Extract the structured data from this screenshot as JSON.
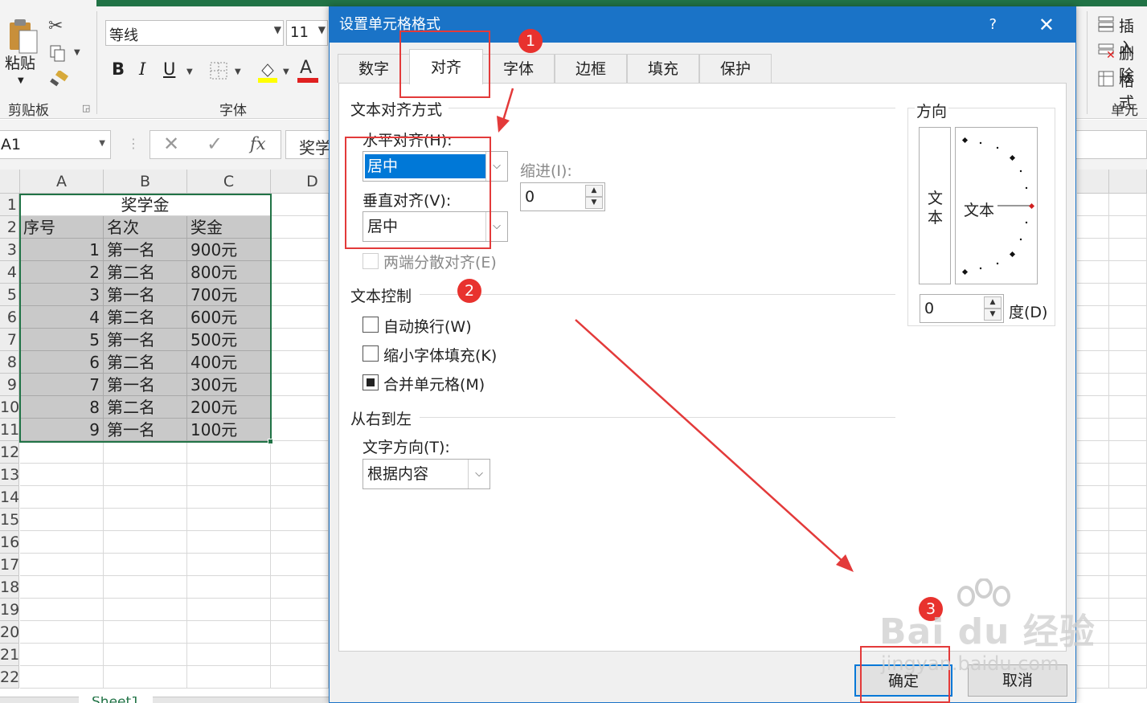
{
  "ribbon": {
    "paste_label": "粘贴",
    "clipboard_group": "剪贴板",
    "font_group": "字体",
    "font_name": "等线",
    "font_size": "11",
    "bold": "B",
    "italic": "I",
    "underline": "U",
    "font_color_letter": "A",
    "insert_label": "插入",
    "delete_label": "删除",
    "format_label": "格式",
    "cells_group": "单元格"
  },
  "formula_bar": {
    "name_box": "A1",
    "fx": "fx",
    "content": "奖学"
  },
  "sheet": {
    "columns": [
      "A",
      "B",
      "C",
      "D"
    ],
    "title": "奖学金",
    "headers": [
      "序号",
      "名次",
      "奖金"
    ],
    "rows": [
      {
        "no": "1",
        "rank": "第一名",
        "amount": "900元"
      },
      {
        "no": "2",
        "rank": "第二名",
        "amount": "800元"
      },
      {
        "no": "3",
        "rank": "第一名",
        "amount": "700元"
      },
      {
        "no": "4",
        "rank": "第二名",
        "amount": "600元"
      },
      {
        "no": "5",
        "rank": "第一名",
        "amount": "500元"
      },
      {
        "no": "6",
        "rank": "第二名",
        "amount": "400元"
      },
      {
        "no": "7",
        "rank": "第一名",
        "amount": "300元"
      },
      {
        "no": "8",
        "rank": "第二名",
        "amount": "200元"
      },
      {
        "no": "9",
        "rank": "第一名",
        "amount": "100元"
      }
    ],
    "row_numbers": [
      "1",
      "2",
      "3",
      "4",
      "5",
      "6",
      "7",
      "8",
      "9",
      "10",
      "11",
      "12",
      "13",
      "14",
      "15",
      "16",
      "17",
      "18",
      "19",
      "20",
      "21",
      "22"
    ],
    "sheet_tab": "Sheet1"
  },
  "dialog": {
    "title": "设置单元格格式",
    "help": "?",
    "close": "✕",
    "tabs": [
      "数字",
      "对齐",
      "字体",
      "边框",
      "填充",
      "保护"
    ],
    "active_tab": "对齐",
    "text_alignment": {
      "section": "文本对齐方式",
      "horizontal_label": "水平对齐(H):",
      "horizontal_value": "居中",
      "indent_label": "缩进(I):",
      "indent_value": "0",
      "vertical_label": "垂直对齐(V):",
      "vertical_value": "居中",
      "distributed_label": "两端分散对齐(E)"
    },
    "text_control": {
      "section": "文本控制",
      "wrap_label": "自动换行(W)",
      "wrap_checked": false,
      "shrink_label": "缩小字体填充(K)",
      "shrink_checked": false,
      "merge_label": "合并单元格(M)",
      "merge_checked": true
    },
    "rtl": {
      "section": "从右到左",
      "direction_label": "文字方向(T):",
      "direction_value": "根据内容"
    },
    "orientation": {
      "section": "方向",
      "vertical_text": "文本",
      "dial_text": "文本",
      "degrees_value": "0",
      "degrees_label": "度(D)"
    },
    "ok_label": "确定",
    "cancel_label": "取消"
  },
  "annotations": {
    "badge1": "1",
    "badge2": "2",
    "badge3": "3",
    "color": "#e33a3a"
  },
  "watermark": {
    "brand": "Bai du 经验",
    "url": "jingyan.baidu.com"
  }
}
